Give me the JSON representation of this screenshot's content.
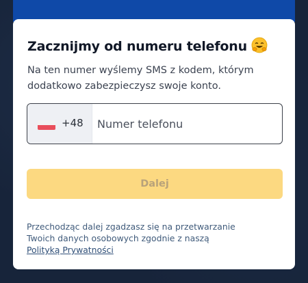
{
  "card": {
    "title": "Zacznijmy od numeru telefonu",
    "title_icon": "hugging-face-emoji-icon",
    "subtitle": "Na ten numer wyślemy SMS z kodem, którym dodatkowo zabezpieczysz swoje konto."
  },
  "phone": {
    "country_flag": "poland-flag-icon",
    "prefix": "+48",
    "placeholder": "Numer telefonu",
    "value": ""
  },
  "next_button": {
    "label": "Dalej",
    "enabled": false
  },
  "consent": {
    "line1": "Przechodząc dalej zgadzasz się na przetwarzanie",
    "line2": "Twoich danych osobowych zgodnie z naszą",
    "link": "Polityką Prywatności"
  },
  "colors": {
    "background": "#17243a",
    "top_bar": "#0f49a8",
    "button_disabled": "#fcd981",
    "link": "#2f4f78"
  }
}
